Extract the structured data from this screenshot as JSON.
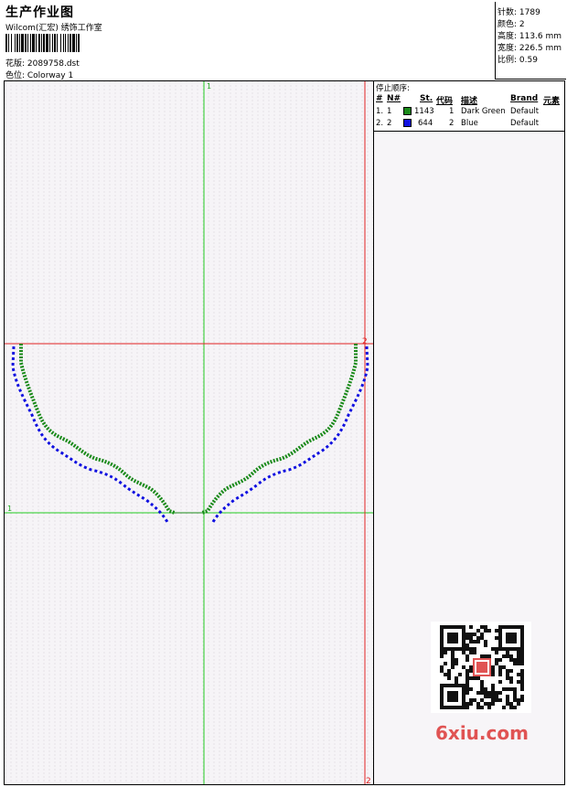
{
  "header": {
    "title": "生产作业图",
    "subtitle": "Wilcom(汇宏) 绣饰工作室",
    "pattern_label": "花版: 2089758.dst",
    "colorway_label": "色位: Colorway 1"
  },
  "info": {
    "stitches": "针数: 1789",
    "colors": "颜色: 2",
    "height": "高度: 113.6 mm",
    "width": "宽度: 226.5 mm",
    "scale": "比例: 0.59"
  },
  "stop_sequence": {
    "title": "停止顺序:",
    "headers": [
      "#",
      "N#",
      "St.",
      "代码",
      "描述",
      "Brand",
      "元素"
    ],
    "rows": [
      {
        "index": "1.",
        "n": "1",
        "stitches": "1143",
        "code": "1",
        "desc": "Dark Green",
        "brand": "Default",
        "color": "#1a8a1a"
      },
      {
        "index": "2.",
        "n": "2",
        "stitches": "644",
        "code": "2",
        "desc": "Blue",
        "brand": "Default",
        "color": "#1010e0"
      }
    ]
  },
  "guides": {
    "green_label": "1",
    "red_label": "2"
  },
  "watermark": "6xiu.com",
  "colors": {
    "green_guide": "#22cc22",
    "red_guide": "#e02020",
    "dark_green": "#1a8a1a",
    "blue": "#1010e0",
    "watermark": "#e05353"
  }
}
